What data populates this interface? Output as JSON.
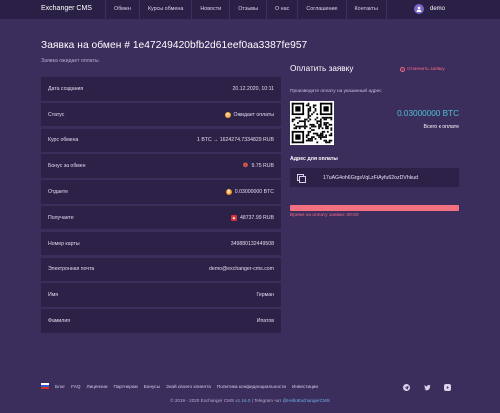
{
  "header": {
    "brand": "Exchanger CMS",
    "nav": [
      "Обмен",
      "Курсы обмена",
      "Новости",
      "Отзывы",
      "О нас",
      "Соглашение",
      "Контакты"
    ],
    "user_name": "demo"
  },
  "page": {
    "title": "Заявка на обмен # 1e47249420bfb2d61eef0aa3387fe957",
    "subtitle": "Заявка ожидает оплаты."
  },
  "details": [
    {
      "label": "Дата создания",
      "value": "20.12.2020, 10:11",
      "icon": ""
    },
    {
      "label": "Статус",
      "value": "Ожидает оплаты",
      "icon": "clock-icon"
    },
    {
      "label": "Курс обмена",
      "value": "1 BTC → 1624274.7334829 RUB",
      "icon": ""
    },
    {
      "label": "Бонус за обмен",
      "value": "9.75 RUB",
      "icon": "bonus-icon"
    },
    {
      "label": "Отдаете",
      "value": "0.03000000 BTC",
      "icon": "bitcoin-icon"
    },
    {
      "label": "Получаете",
      "value": "48737.99 RUB",
      "icon": "bank-icon"
    },
    {
      "label": "Номер карты",
      "value": "349880132449508",
      "icon": ""
    },
    {
      "label": "Электронная почта",
      "value": "demo@exchanger-cms.com",
      "icon": ""
    },
    {
      "label": "Имя",
      "value": "Герман",
      "icon": ""
    },
    {
      "label": "Фамилия",
      "value": "Ипатов",
      "icon": ""
    }
  ],
  "payment": {
    "title": "Оплатить заявку",
    "cancel_label": "Отменить заявку",
    "instruction": "Произведите оплату на указанный адрес",
    "amount": "0.03000000 BTC",
    "amount_label": "Всего к оплате",
    "address_label": "Адрес для оплаты",
    "address": "17uAG4oh6GrgsVqLzFiAyfu62ozDVhkud",
    "timer_label": "Время на оплату заявки: 00:00",
    "progress": 1.0
  },
  "footer": {
    "links": [
      "Блог",
      "FAQ",
      "Лицензии",
      "Партнерам",
      "Бонусы",
      "Знай своего клиента",
      "Политика конфиденциальности",
      "Инвестиции"
    ],
    "copyright_prefix": "© 2019 - 2020 Exchanger CMS v",
    "version": "1.16.0",
    "telegram_prefix": " | Telegram чат ",
    "telegram_handle": "@HelloExchangerCMS"
  },
  "colors": {
    "background": "#3b2d5c",
    "panel": "#2c2147",
    "accent_cyan": "#4fc3d6",
    "accent_pink": "#f06a86",
    "progress_fill": "#f2707f"
  }
}
